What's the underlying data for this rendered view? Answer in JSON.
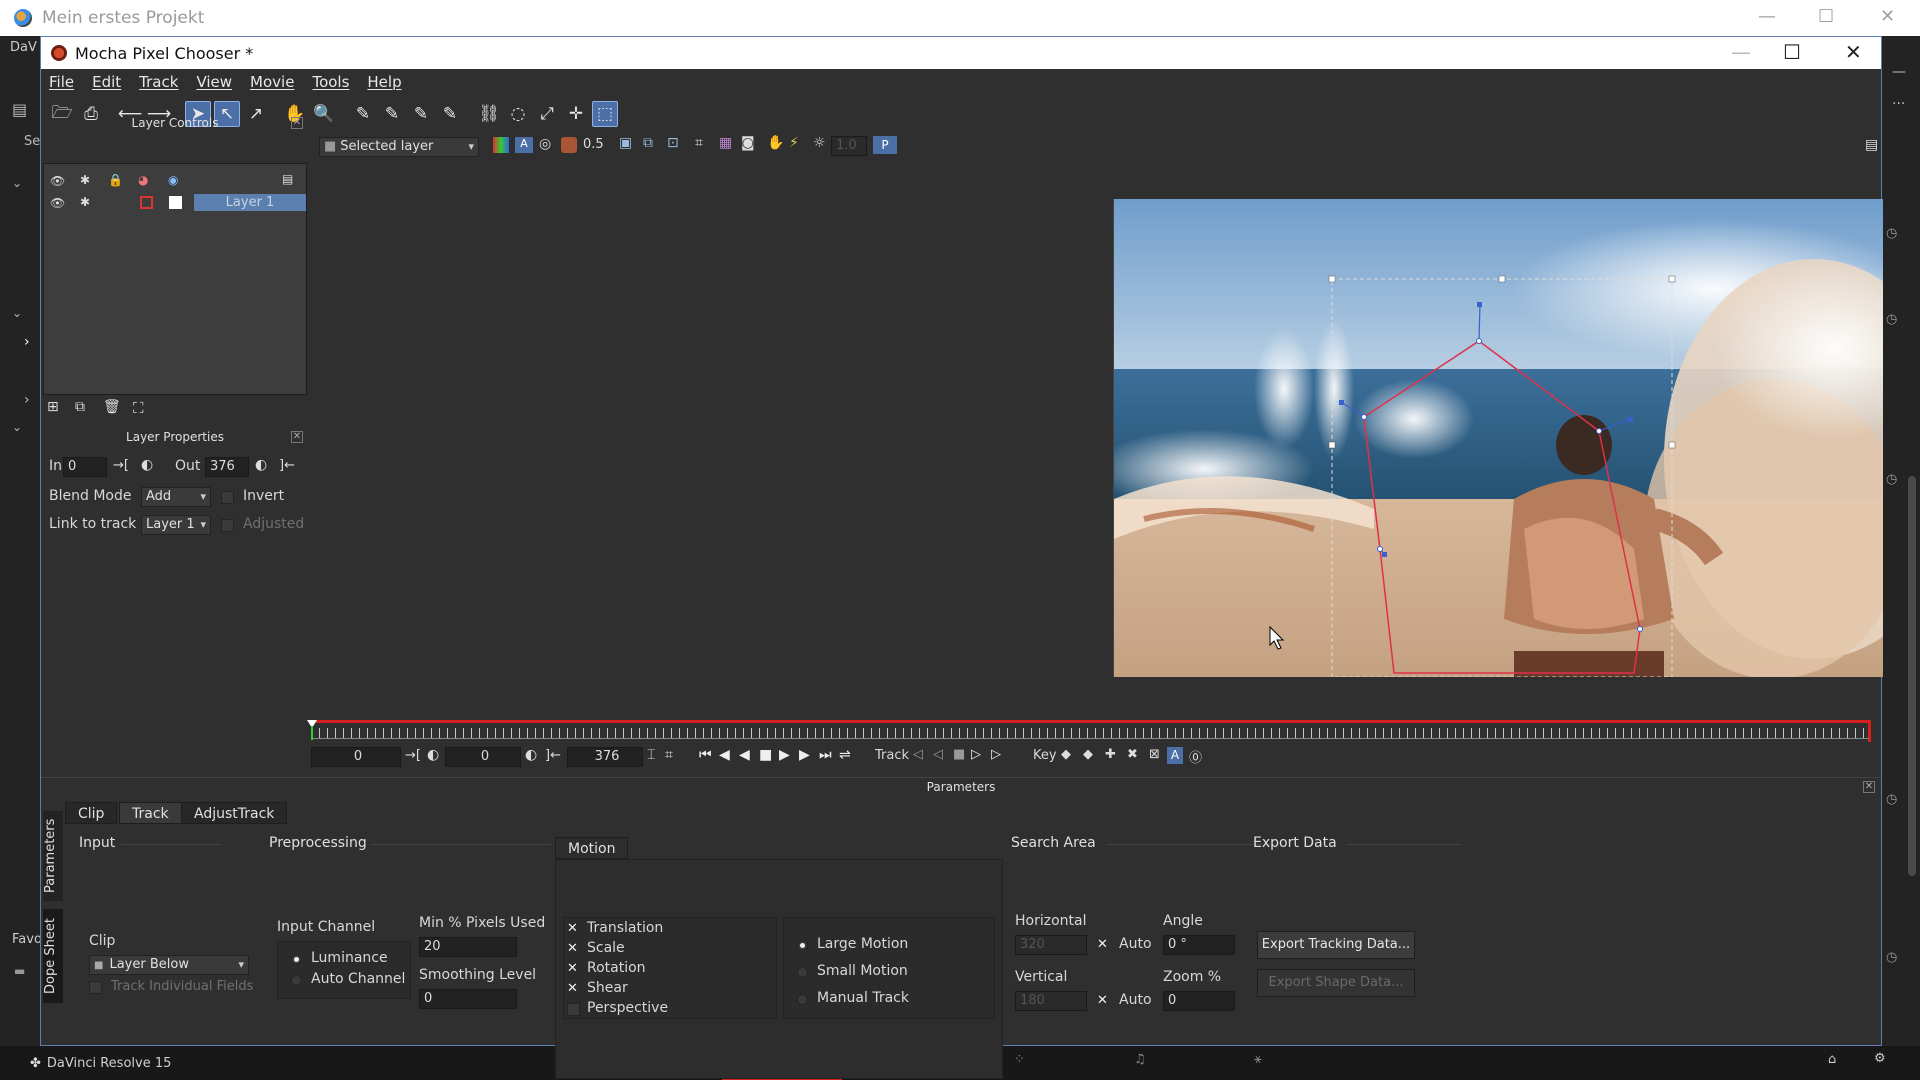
{
  "outer": {
    "title": "Mein erstes Projekt",
    "bottom_app": "DaVinci Resolve 15",
    "left_labels": [
      "DaV",
      "Se",
      "Favo"
    ]
  },
  "window": {
    "title": "Mocha Pixel Chooser *"
  },
  "menu": [
    "File",
    "Edit",
    "Track",
    "View",
    "Movie",
    "Tools",
    "Help"
  ],
  "toolbar": {
    "layer_select": "Selected layer",
    "opacity": "0.5",
    "gamma": "1.0",
    "p_label": "P"
  },
  "layer_controls": {
    "title": "Layer Controls",
    "layer_name": "Layer 1"
  },
  "layer_properties": {
    "title": "Layer Properties",
    "in_label": "In",
    "in_value": "0",
    "out_label": "Out",
    "out_value": "376",
    "blend_label": "Blend Mode",
    "blend_value": "Add",
    "invert_label": "Invert",
    "link_label": "Link to track",
    "link_value": "Layer 1",
    "adjusted_label": "Adjusted"
  },
  "transport": {
    "current": "0",
    "in": "0",
    "out": "376",
    "track_label": "Track",
    "key_label": "Key"
  },
  "params": {
    "title": "Parameters",
    "tabs": [
      "Clip",
      "Track",
      "AdjustTrack"
    ],
    "side_tabs": [
      "Parameters",
      "Dope Sheet"
    ],
    "input_head": "Input",
    "clip_label": "Clip",
    "clip_value": "Layer Below",
    "track_fields": "Track Individual Fields",
    "pre_head": "Preprocessing",
    "input_channel": "Input Channel",
    "luminance": "Luminance",
    "auto_channel": "Auto Channel",
    "min_pixels_label": "Min % Pixels Used",
    "min_pixels_value": "20",
    "smoothing_label": "Smoothing Level",
    "smoothing_value": "0",
    "motion_tab": "Motion",
    "motion_checks": [
      "Translation",
      "Scale",
      "Rotation",
      "Shear",
      "Perspective"
    ],
    "motion_types": [
      "Large Motion",
      "Small Motion",
      "Manual Track"
    ],
    "search_head": "Search Area",
    "horizontal_label": "Horizontal",
    "horizontal_value": "320",
    "vertical_label": "Vertical",
    "vertical_value": "180",
    "auto_label": "Auto",
    "angle_label": "Angle",
    "angle_value": "0 °",
    "zoom_label": "Zoom %",
    "zoom_value": "0",
    "export_head": "Export Data",
    "export_tracking": "Export Tracking Data...",
    "export_shape": "Export Shape Data..."
  },
  "colors": {
    "accent": "#5b7fae",
    "timeline_red": "#d62020",
    "spline": "#e0304a"
  }
}
